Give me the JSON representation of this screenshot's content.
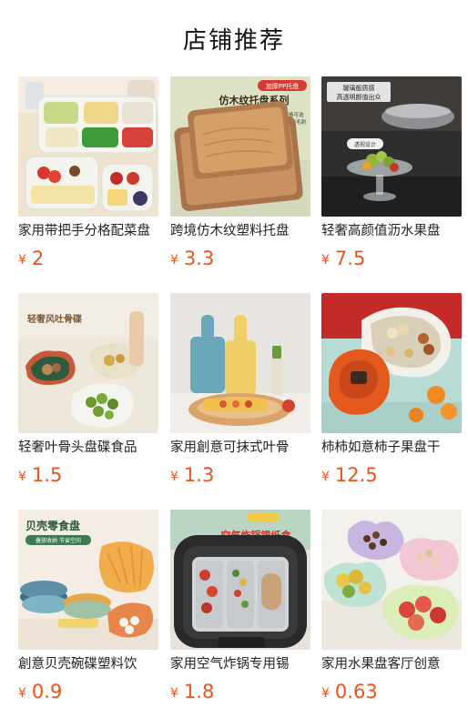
{
  "header": {
    "title": "店铺推荐"
  },
  "currency": "¥",
  "products": [
    {
      "title": "家用带把手分格配菜盘",
      "price": "2",
      "image": {
        "name": "divided-platter-image",
        "overlay": []
      }
    },
    {
      "title": "跨境仿木纹塑料托盘",
      "price": "3.3",
      "image": {
        "name": "wood-tray-image",
        "overlay": [
          "加厚PP托盘",
          "仿木纹托盘系列",
          "多种规格可选",
          "边缘圆滑无毛刺"
        ]
      }
    },
    {
      "title": "轻奢高颜值沥水果盘",
      "price": "7.5",
      "image": {
        "name": "glass-fruit-bowl-image",
        "overlay": [
          "玻璃般质感",
          "高透明颜值出众",
          "透视设计"
        ]
      }
    },
    {
      "title": "轻奢叶骨头盘碟食品",
      "price": "1.5",
      "image": {
        "name": "leaf-bone-plate-image",
        "overlay": [
          "轻奢风吐骨碟"
        ]
      }
    },
    {
      "title": "家用創意可抹式叶骨",
      "price": "1.3",
      "image": {
        "name": "paddle-plate-image",
        "overlay": []
      }
    },
    {
      "title": "柿柿如意柿子果盘干",
      "price": "12.5",
      "image": {
        "name": "persimmon-box-image",
        "overlay": []
      }
    },
    {
      "title": "創意贝壳碗碟塑料饮",
      "price": "0.9",
      "image": {
        "name": "shell-plate-image",
        "overlay": [
          "贝壳零食盘",
          "叠放收纳 节省空间"
        ]
      }
    },
    {
      "title": "家用空气炸锅专用锡",
      "price": "1.8",
      "image": {
        "name": "air-fryer-foil-image",
        "overlay": [
          "空气炸锅锡纸盒"
        ]
      }
    },
    {
      "title": "家用水果盘客厅创意",
      "price": "0.63",
      "image": {
        "name": "flower-fruit-bowl-image",
        "overlay": []
      }
    }
  ]
}
